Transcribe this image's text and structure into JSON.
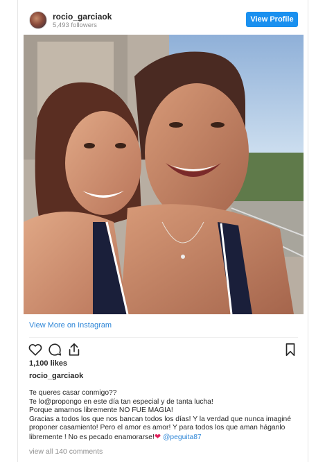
{
  "header": {
    "username": "rocio_garciaok",
    "followers": "5,493 followers",
    "view_profile_label": "View Profile"
  },
  "post": {
    "view_more_label": "View More on Instagram",
    "likes": "1,100 likes",
    "caption_user": "rocio_garciaok",
    "caption_lines": [
      "Te queres casar conmigo??",
      "Te lo@propongo en este día tan especial y de tanta lucha!",
      "Porque amarnos libremente NO FUE MAGIA!",
      "Gracias a todos los que nos bancan todos los días! Y la verdad que nunca imaginé",
      "proponer casamiento! Pero el amor es amor! Y para todos los que aman háganlo",
      "libremente ! No es pecado enamorarse!"
    ],
    "caption_mention": "@peguita87",
    "comments_label": "view all 140 comments"
  },
  "icons": {
    "like": "heart-icon",
    "comment": "comment-icon",
    "share": "share-icon",
    "save": "bookmark-icon",
    "inline_heart": "red-heart-emoji"
  },
  "colors": {
    "accent": "#1a90ef",
    "link": "#2e86d7",
    "muted": "#8e8e8e",
    "heart": "#e0245e"
  }
}
